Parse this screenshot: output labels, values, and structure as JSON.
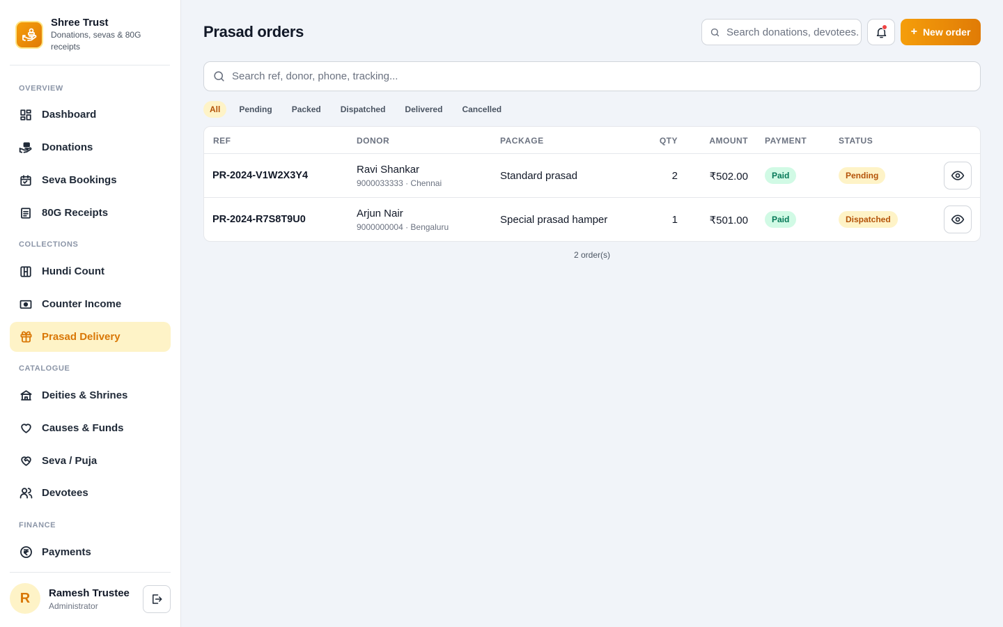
{
  "brand": {
    "name": "Shree Trust",
    "subtitle": "Donations, sevas & 80G receipts",
    "logo_icon": "hand-coin-icon",
    "accent": "#f59e0b"
  },
  "sidebar": {
    "sections": [
      {
        "title": "OVERVIEW"
      },
      {
        "title": "COLLECTIONS"
      },
      {
        "title": "CATALOGUE"
      },
      {
        "title": "FINANCE"
      }
    ],
    "items": [
      {
        "label": "Dashboard",
        "icon": "dashboard-icon"
      },
      {
        "label": "Donations",
        "icon": "donation-hand-icon"
      },
      {
        "label": "Seva Bookings",
        "icon": "calendar-icon"
      },
      {
        "label": "80G Receipts",
        "icon": "receipt-icon"
      },
      {
        "label": "Hundi Count",
        "icon": "hundi-icon"
      },
      {
        "label": "Counter Income",
        "icon": "cash-icon"
      },
      {
        "label": "Prasad Delivery",
        "icon": "gift-icon",
        "active": true
      },
      {
        "label": "Deities & Shrines",
        "icon": "temple-icon"
      },
      {
        "label": "Causes & Funds",
        "icon": "heart-icon"
      },
      {
        "label": "Seva / Puja",
        "icon": "heart-handshake-icon"
      },
      {
        "label": "Devotees",
        "icon": "users-icon"
      },
      {
        "label": "Payments",
        "icon": "rupee-circle-icon"
      }
    ]
  },
  "user": {
    "initial": "R",
    "name": "Ramesh Trustee",
    "role": "Administrator"
  },
  "header": {
    "title": "Prasad orders",
    "search_placeholder": "Search donations, devotees...",
    "new_order_label": "New order",
    "notification_dot_color": "#ef4444"
  },
  "orders": {
    "search_placeholder": "Search ref, donor, phone, tracking...",
    "filters": [
      "All",
      "Pending",
      "Packed",
      "Dispatched",
      "Delivered",
      "Cancelled"
    ],
    "active_filter": "All",
    "columns": [
      "REF",
      "DONOR",
      "PACKAGE",
      "QTY",
      "AMOUNT",
      "PAYMENT",
      "STATUS"
    ],
    "rows": [
      {
        "ref": "PR-2024-V1W2X3Y4",
        "donor": "Ravi Shankar",
        "donor_meta": "9000033333 · Chennai",
        "package": "Standard prasad",
        "qty": "2",
        "amount": "₹502.00",
        "payment": "Paid",
        "status": "Pending"
      },
      {
        "ref": "PR-2024-R7S8T9U0",
        "donor": "Arjun Nair",
        "donor_meta": "9000000004 · Bengaluru",
        "package": "Special prasad hamper",
        "qty": "1",
        "amount": "₹501.00",
        "payment": "Paid",
        "status": "Dispatched"
      }
    ],
    "count_text": "2 order(s)"
  }
}
